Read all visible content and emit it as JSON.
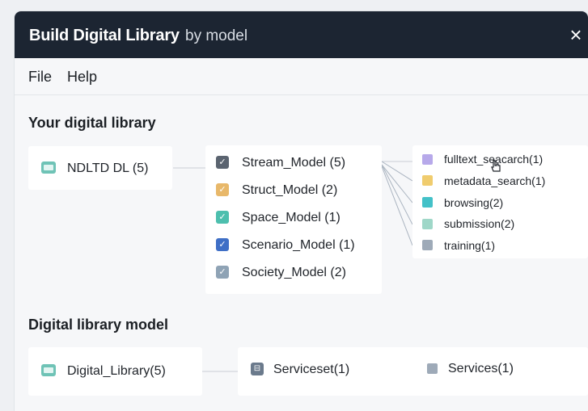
{
  "window": {
    "title_main": "Build Digital Library",
    "title_sub": "by model",
    "close_glyph": "×"
  },
  "menu": [
    "File",
    "Help"
  ],
  "sections": {
    "your_library": "Your digital library",
    "library_model": "Digital library model"
  },
  "library_node": {
    "label": "NDLTD DL (5)",
    "icon": "folder-icon"
  },
  "models": [
    {
      "label": "Stream_Model (5)",
      "color": "#5b6470",
      "icon": "checkbox-icon"
    },
    {
      "label": "Struct_Model (2)",
      "color": "#e8b86a",
      "icon": "checkbox-icon"
    },
    {
      "label": "Space_Model (1)",
      "color": "#4dbfae",
      "icon": "checkbox-icon"
    },
    {
      "label": "Scenario_Model (1)",
      "color": "#3f6fc6",
      "icon": "checkbox-icon"
    },
    {
      "label": "Society_Model (2)",
      "color": "#8fa3b5",
      "icon": "checkbox-icon"
    }
  ],
  "services": [
    {
      "label": "fulltext_seacarch(1)",
      "color": "#b7a9ea"
    },
    {
      "label": "metadata_search(1)",
      "color": "#f0cc6e"
    },
    {
      "label": "browsing(2)",
      "color": "#43c1c8"
    },
    {
      "label": "submission(2)",
      "color": "#9fd7c8"
    },
    {
      "label": "training(1)",
      "color": "#9eaab8"
    }
  ],
  "model_row": {
    "digital_library": "Digital_Library(5)",
    "serviceset": "Serviceset(1)",
    "services": "Services(1)",
    "serviceset_color": "#6b7a8c",
    "services_color": "#9eaab8"
  }
}
